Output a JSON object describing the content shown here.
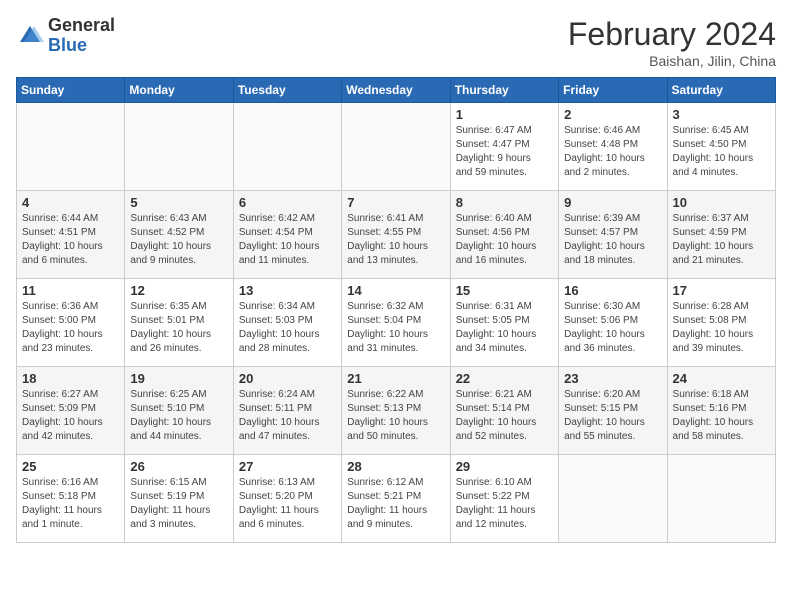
{
  "header": {
    "logo_general": "General",
    "logo_blue": "Blue",
    "month": "February 2024",
    "location": "Baishan, Jilin, China"
  },
  "days_of_week": [
    "Sunday",
    "Monday",
    "Tuesday",
    "Wednesday",
    "Thursday",
    "Friday",
    "Saturday"
  ],
  "weeks": [
    [
      {
        "day": "",
        "info": ""
      },
      {
        "day": "",
        "info": ""
      },
      {
        "day": "",
        "info": ""
      },
      {
        "day": "",
        "info": ""
      },
      {
        "day": "1",
        "info": "Sunrise: 6:47 AM\nSunset: 4:47 PM\nDaylight: 9 hours\nand 59 minutes."
      },
      {
        "day": "2",
        "info": "Sunrise: 6:46 AM\nSunset: 4:48 PM\nDaylight: 10 hours\nand 2 minutes."
      },
      {
        "day": "3",
        "info": "Sunrise: 6:45 AM\nSunset: 4:50 PM\nDaylight: 10 hours\nand 4 minutes."
      }
    ],
    [
      {
        "day": "4",
        "info": "Sunrise: 6:44 AM\nSunset: 4:51 PM\nDaylight: 10 hours\nand 6 minutes."
      },
      {
        "day": "5",
        "info": "Sunrise: 6:43 AM\nSunset: 4:52 PM\nDaylight: 10 hours\nand 9 minutes."
      },
      {
        "day": "6",
        "info": "Sunrise: 6:42 AM\nSunset: 4:54 PM\nDaylight: 10 hours\nand 11 minutes."
      },
      {
        "day": "7",
        "info": "Sunrise: 6:41 AM\nSunset: 4:55 PM\nDaylight: 10 hours\nand 13 minutes."
      },
      {
        "day": "8",
        "info": "Sunrise: 6:40 AM\nSunset: 4:56 PM\nDaylight: 10 hours\nand 16 minutes."
      },
      {
        "day": "9",
        "info": "Sunrise: 6:39 AM\nSunset: 4:57 PM\nDaylight: 10 hours\nand 18 minutes."
      },
      {
        "day": "10",
        "info": "Sunrise: 6:37 AM\nSunset: 4:59 PM\nDaylight: 10 hours\nand 21 minutes."
      }
    ],
    [
      {
        "day": "11",
        "info": "Sunrise: 6:36 AM\nSunset: 5:00 PM\nDaylight: 10 hours\nand 23 minutes."
      },
      {
        "day": "12",
        "info": "Sunrise: 6:35 AM\nSunset: 5:01 PM\nDaylight: 10 hours\nand 26 minutes."
      },
      {
        "day": "13",
        "info": "Sunrise: 6:34 AM\nSunset: 5:03 PM\nDaylight: 10 hours\nand 28 minutes."
      },
      {
        "day": "14",
        "info": "Sunrise: 6:32 AM\nSunset: 5:04 PM\nDaylight: 10 hours\nand 31 minutes."
      },
      {
        "day": "15",
        "info": "Sunrise: 6:31 AM\nSunset: 5:05 PM\nDaylight: 10 hours\nand 34 minutes."
      },
      {
        "day": "16",
        "info": "Sunrise: 6:30 AM\nSunset: 5:06 PM\nDaylight: 10 hours\nand 36 minutes."
      },
      {
        "day": "17",
        "info": "Sunrise: 6:28 AM\nSunset: 5:08 PM\nDaylight: 10 hours\nand 39 minutes."
      }
    ],
    [
      {
        "day": "18",
        "info": "Sunrise: 6:27 AM\nSunset: 5:09 PM\nDaylight: 10 hours\nand 42 minutes."
      },
      {
        "day": "19",
        "info": "Sunrise: 6:25 AM\nSunset: 5:10 PM\nDaylight: 10 hours\nand 44 minutes."
      },
      {
        "day": "20",
        "info": "Sunrise: 6:24 AM\nSunset: 5:11 PM\nDaylight: 10 hours\nand 47 minutes."
      },
      {
        "day": "21",
        "info": "Sunrise: 6:22 AM\nSunset: 5:13 PM\nDaylight: 10 hours\nand 50 minutes."
      },
      {
        "day": "22",
        "info": "Sunrise: 6:21 AM\nSunset: 5:14 PM\nDaylight: 10 hours\nand 52 minutes."
      },
      {
        "day": "23",
        "info": "Sunrise: 6:20 AM\nSunset: 5:15 PM\nDaylight: 10 hours\nand 55 minutes."
      },
      {
        "day": "24",
        "info": "Sunrise: 6:18 AM\nSunset: 5:16 PM\nDaylight: 10 hours\nand 58 minutes."
      }
    ],
    [
      {
        "day": "25",
        "info": "Sunrise: 6:16 AM\nSunset: 5:18 PM\nDaylight: 11 hours\nand 1 minute."
      },
      {
        "day": "26",
        "info": "Sunrise: 6:15 AM\nSunset: 5:19 PM\nDaylight: 11 hours\nand 3 minutes."
      },
      {
        "day": "27",
        "info": "Sunrise: 6:13 AM\nSunset: 5:20 PM\nDaylight: 11 hours\nand 6 minutes."
      },
      {
        "day": "28",
        "info": "Sunrise: 6:12 AM\nSunset: 5:21 PM\nDaylight: 11 hours\nand 9 minutes."
      },
      {
        "day": "29",
        "info": "Sunrise: 6:10 AM\nSunset: 5:22 PM\nDaylight: 11 hours\nand 12 minutes."
      },
      {
        "day": "",
        "info": ""
      },
      {
        "day": "",
        "info": ""
      }
    ]
  ]
}
